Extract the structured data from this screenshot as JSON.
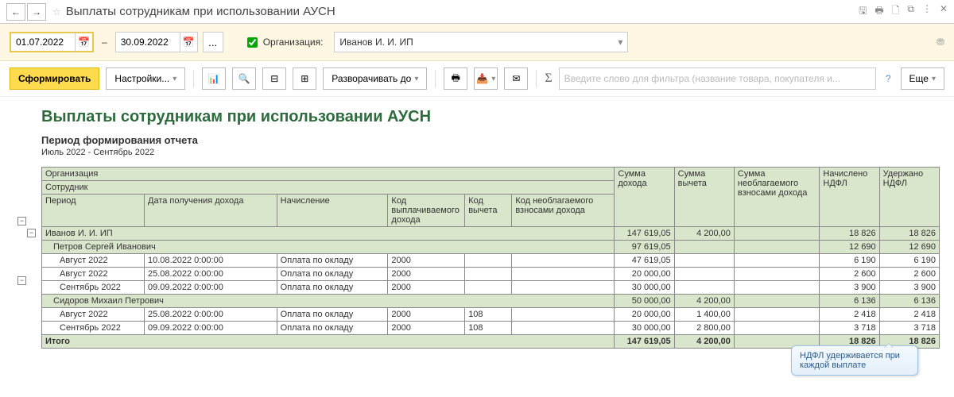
{
  "titlebar": {
    "title": "Выплаты сотрудникам при использовании АУСН"
  },
  "filter": {
    "date_from": "01.07.2022",
    "date_to": "30.09.2022",
    "org_label": "Организация:",
    "org_value": "Иванов И. И. ИП"
  },
  "toolbar": {
    "generate": "Сформировать",
    "settings": "Настройки...",
    "expand": "Разворачивать до",
    "more": "Еще",
    "filter_placeholder": "Введите слово для фильтра (название товара, покупателя и..."
  },
  "report": {
    "title": "Выплаты сотрудникам при использовании АУСН",
    "subtitle": "Период формирования отчета",
    "period": "Июль 2022 - Сентябрь 2022",
    "callout": "НДФЛ удерживается при каждой выплате"
  },
  "headers": {
    "org": "Организация",
    "emp": "Сотрудник",
    "period": "Период",
    "date_income": "Дата получения дохода",
    "accrual": "Начисление",
    "code_paid": "Код выплачиваемого дохода",
    "code_ded": "Код вычета",
    "code_nontax": "Код необлагаемого взносами дохода",
    "sum_income": "Сумма дохода",
    "sum_ded": "Сумма вычета",
    "sum_nontax": "Сумма необлагаемого взносами дохода",
    "ndfl_acc": "Начислено НДФЛ",
    "ndfl_with": "Удержано НДФЛ",
    "total": "Итого"
  },
  "rows": {
    "org1": {
      "name": "Иванов И. И. ИП",
      "income": "147 619,05",
      "ded": "4 200,00",
      "ndfl_a": "18 826",
      "ndfl_w": "18 826"
    },
    "emp1": {
      "name": "Петров Сергей Иванович",
      "income": "97 619,05",
      "ndfl_a": "12 690",
      "ndfl_w": "12 690"
    },
    "r1": {
      "period": "Август 2022",
      "date": "10.08.2022 0:00:00",
      "acc": "Оплата по окладу",
      "code": "2000",
      "income": "47 619,05",
      "ndfl_a": "6 190",
      "ndfl_w": "6 190"
    },
    "r2": {
      "period": "Август 2022",
      "date": "25.08.2022 0:00:00",
      "acc": "Оплата по окладу",
      "code": "2000",
      "income": "20 000,00",
      "ndfl_a": "2 600",
      "ndfl_w": "2 600"
    },
    "r3": {
      "period": "Сентябрь 2022",
      "date": "09.09.2022 0:00:00",
      "acc": "Оплата по окладу",
      "code": "2000",
      "income": "30 000,00",
      "ndfl_a": "3 900",
      "ndfl_w": "3 900"
    },
    "emp2": {
      "name": "Сидоров Михаил Петрович",
      "income": "50 000,00",
      "ded": "4 200,00",
      "ndfl_a": "6 136",
      "ndfl_w": "6 136"
    },
    "r4": {
      "period": "Август 2022",
      "date": "25.08.2022 0:00:00",
      "acc": "Оплата по окладу",
      "code": "2000",
      "dedc": "108",
      "income": "20 000,00",
      "ded": "1 400,00",
      "ndfl_a": "2 418",
      "ndfl_w": "2 418"
    },
    "r5": {
      "period": "Сентябрь 2022",
      "date": "09.09.2022 0:00:00",
      "acc": "Оплата по окладу",
      "code": "2000",
      "dedc": "108",
      "income": "30 000,00",
      "ded": "2 800,00",
      "ndfl_a": "3 718",
      "ndfl_w": "3 718"
    },
    "total": {
      "income": "147 619,05",
      "ded": "4 200,00",
      "ndfl_a": "18 826",
      "ndfl_w": "18 826"
    }
  }
}
